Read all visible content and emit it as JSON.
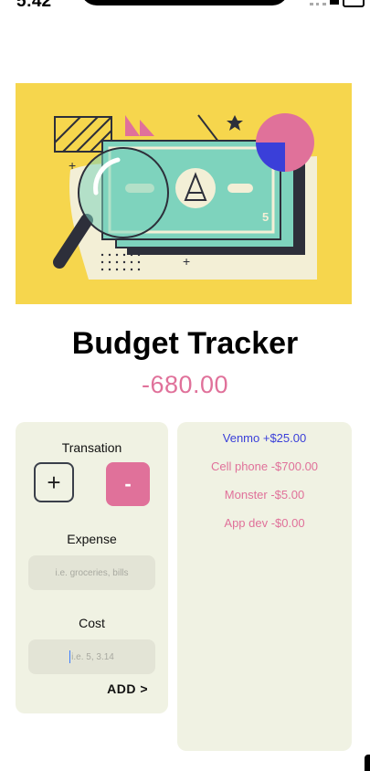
{
  "status": {
    "time": "5:42"
  },
  "hero": {
    "image": "money-magnifier-illustration"
  },
  "header": {
    "title": "Budget Tracker",
    "total": "-680.00"
  },
  "form": {
    "transaction_label": "Transation",
    "plus_label": "+",
    "minus_label": "-",
    "expense_label": "Expense",
    "expense_placeholder": "i.e. groceries, bills",
    "cost_label": "Cost",
    "cost_placeholder": "i.e. 5, 3.14",
    "add_label": "ADD >"
  },
  "transactions": [
    {
      "text": "Venmo +$25.00",
      "type": "income"
    },
    {
      "text": "Cell phone -$700.00",
      "type": "expense"
    },
    {
      "text": "Monster -$5.00",
      "type": "expense"
    },
    {
      "text": "App dev -$0.00",
      "type": "expense"
    }
  ],
  "colors": {
    "income": "#3a3fd9",
    "expense": "#e0719a",
    "accent": "#e0719a",
    "hero_bg": "#f6d64d",
    "panel_bg": "#f0f2e3"
  }
}
